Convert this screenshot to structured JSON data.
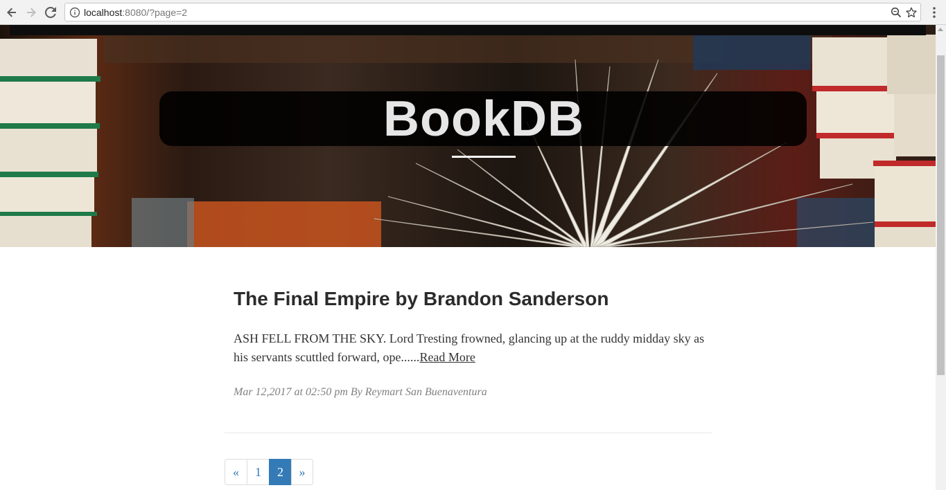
{
  "browser": {
    "url_host": "localhost",
    "url_rest": ":8080/?page=2"
  },
  "hero": {
    "title": "BookDB"
  },
  "post": {
    "title": "The Final Empire by Brandon Sanderson",
    "excerpt": "ASH FELL FROM THE SKY. Lord Tresting frowned, glancing up at the ruddy midday sky as his servants scuttled forward, ope......",
    "read_more": "Read More",
    "meta": "Mar 12,2017 at 02:50 pm By Reymart San Buenaventura"
  },
  "pagination": {
    "prev": "«",
    "pages": [
      "1",
      "2"
    ],
    "current": "2",
    "next": "»"
  },
  "colors": {
    "link": "#337ab7",
    "active_page_bg": "#337ab7"
  }
}
